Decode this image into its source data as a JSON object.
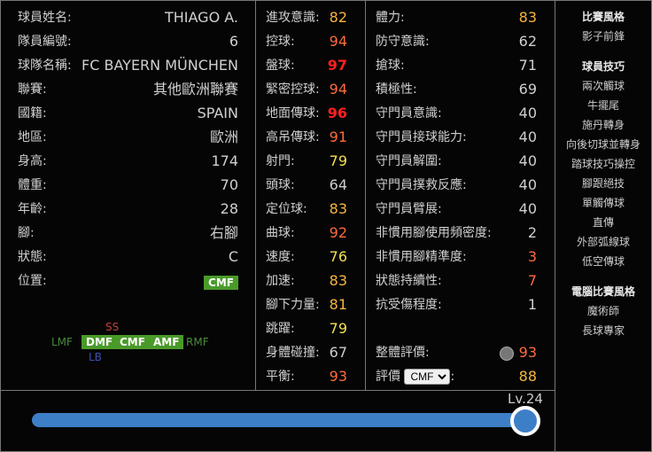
{
  "profile": [
    {
      "label": "球員姓名:",
      "value": "THIAGO A."
    },
    {
      "label": "隊員編號:",
      "value": "6"
    },
    {
      "label": "球隊名稱:",
      "value": "FC BAYERN MÜNCHEN"
    },
    {
      "label": "聯賽:",
      "value": "其他歐洲聯賽"
    },
    {
      "label": "國籍:",
      "value": "SPAIN"
    },
    {
      "label": "地區:",
      "value": "歐洲"
    },
    {
      "label": "身高:",
      "value": "174"
    },
    {
      "label": "體重:",
      "value": "70"
    },
    {
      "label": "年齡:",
      "value": "28"
    },
    {
      "label": "腳:",
      "value": "右腳"
    },
    {
      "label": "狀態:",
      "value": "C"
    },
    {
      "label": "位置:",
      "value": "CMF"
    }
  ],
  "positions": {
    "ss": "SS",
    "lmf": "LMF",
    "dmf": "DMF",
    "cmf": "CMF",
    "amf": "AMF",
    "rmf": "RMF",
    "lb": "LB"
  },
  "stats1": [
    {
      "label": "進攻意識:",
      "value": "82",
      "tier": "o"
    },
    {
      "label": "控球:",
      "value": "94",
      "tier": "r"
    },
    {
      "label": "盤球:",
      "value": "97",
      "tier": "R"
    },
    {
      "label": "緊密控球:",
      "value": "94",
      "tier": "r"
    },
    {
      "label": "地面傳球:",
      "value": "96",
      "tier": "R"
    },
    {
      "label": "高吊傳球:",
      "value": "91",
      "tier": "r"
    },
    {
      "label": "射門:",
      "value": "79",
      "tier": "y"
    },
    {
      "label": "頭球:",
      "value": "64",
      "tier": "g"
    },
    {
      "label": "定位球:",
      "value": "83",
      "tier": "o"
    },
    {
      "label": "曲球:",
      "value": "92",
      "tier": "r"
    },
    {
      "label": "速度:",
      "value": "76",
      "tier": "y"
    },
    {
      "label": "加速:",
      "value": "83",
      "tier": "o"
    },
    {
      "label": "腳下力量:",
      "value": "81",
      "tier": "o"
    },
    {
      "label": "跳躍:",
      "value": "79",
      "tier": "y"
    },
    {
      "label": "身體碰撞:",
      "value": "67",
      "tier": "g"
    },
    {
      "label": "平衡:",
      "value": "93",
      "tier": "r"
    }
  ],
  "stats2": [
    {
      "label": "體力:",
      "value": "83",
      "tier": "o"
    },
    {
      "label": "防守意識:",
      "value": "62",
      "tier": "g"
    },
    {
      "label": "搶球:",
      "value": "71",
      "tier": "g"
    },
    {
      "label": "積極性:",
      "value": "69",
      "tier": "g"
    },
    {
      "label": "守門員意識:",
      "value": "40",
      "tier": "g"
    },
    {
      "label": "守門員接球能力:",
      "value": "40",
      "tier": "g"
    },
    {
      "label": "守門員解圍:",
      "value": "40",
      "tier": "g"
    },
    {
      "label": "守門員撲救反應:",
      "value": "40",
      "tier": "g"
    },
    {
      "label": "守門員臂展:",
      "value": "40",
      "tier": "g"
    },
    {
      "label": "非慣用腳使用頻密度:",
      "value": "2",
      "tier": "g"
    },
    {
      "label": "非慣用腳精準度:",
      "value": "3",
      "tier": "r"
    },
    {
      "label": "狀態持續性:",
      "value": "7",
      "tier": "r"
    },
    {
      "label": "抗受傷程度:",
      "value": "1",
      "tier": "g"
    }
  ],
  "overall": {
    "label": "整體評價:",
    "value": "93"
  },
  "rating": {
    "label": "評價",
    "selected": "CMF",
    "colon": ":",
    "value": "88"
  },
  "sidebar": {
    "style_title": "比賽風格",
    "styles": [
      "影子前鋒"
    ],
    "skills_title": "球員技巧",
    "skills": [
      "兩次觸球",
      "牛擺尾",
      "施丹轉身",
      "向後切球並轉身",
      "踏球技巧操控",
      "腳跟絕技",
      "單觸傳球",
      "直傳",
      "外部弧線球",
      "低空傳球"
    ],
    "ai_title": "電腦比賽風格",
    "ai": [
      "魔術師",
      "長球專家"
    ]
  },
  "level": {
    "label": "Lv.24",
    "fraction": 1.0
  }
}
